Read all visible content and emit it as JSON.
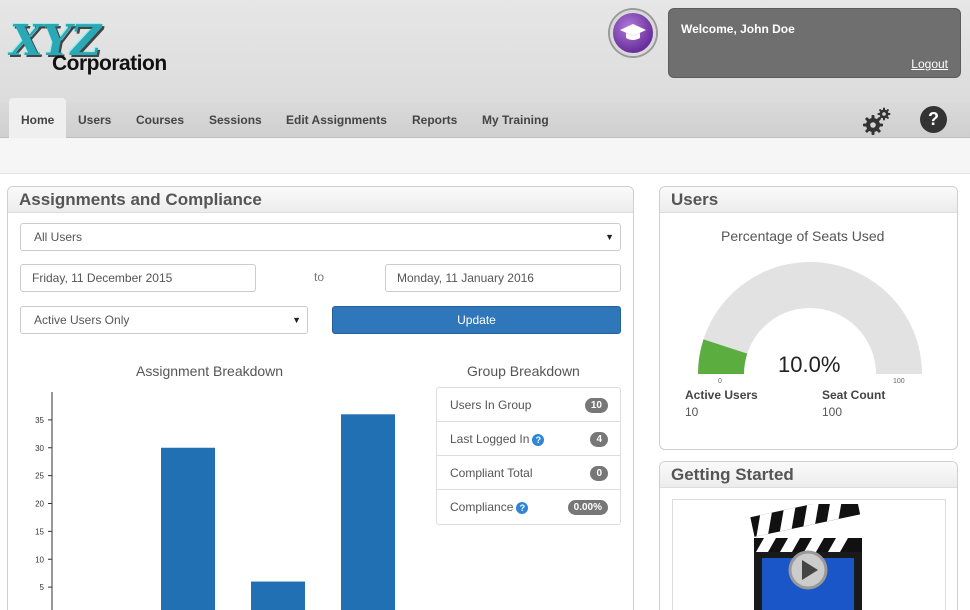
{
  "header": {
    "logo_main": "XYZ",
    "logo_sub": "Corporation",
    "welcome": "Welcome, John Doe",
    "logout": "Logout"
  },
  "nav": {
    "items": [
      "Home",
      "Users",
      "Courses",
      "Sessions",
      "Edit Assignments",
      "Reports",
      "My Training"
    ],
    "active": "Home",
    "icons": [
      "gear-icon",
      "help-icon"
    ]
  },
  "assignments": {
    "title": "Assignments and Compliance",
    "user_filter": "All Users",
    "date_from": "Friday, 11 December 2015",
    "to_label": "to",
    "date_to": "Monday, 11 January 2016",
    "status_filter": "Active Users Only",
    "update_label": "Update",
    "breakdown_title": "Assignment Breakdown",
    "group_title": "Group Breakdown",
    "group_rows": [
      {
        "label": "Users In Group",
        "value": "10",
        "info": false
      },
      {
        "label": "Last Logged In",
        "value": "4",
        "info": true
      },
      {
        "label": "Compliant Total",
        "value": "0",
        "info": false
      },
      {
        "label": "Compliance",
        "value": "0.00%",
        "info": true
      }
    ]
  },
  "users": {
    "title": "Users",
    "gauge_title": "Percentage of Seats Used",
    "gauge_value": "10.0%",
    "gauge_fraction": 0.1,
    "gauge_min": "0",
    "gauge_max": "100",
    "active_label": "Active Users",
    "active_value": "10",
    "seat_label": "Seat Count",
    "seat_value": "100",
    "fill_color": "#5aad3e"
  },
  "getting_started": {
    "title": "Getting Started"
  },
  "chart_data": {
    "type": "bar",
    "title": "Assignment Breakdown",
    "y_ticks": [
      "5",
      "10",
      "15",
      "20",
      "25",
      "30",
      "35"
    ],
    "ylim": [
      0,
      40
    ],
    "values": [
      30,
      6,
      36
    ],
    "color": "#2170b3"
  }
}
